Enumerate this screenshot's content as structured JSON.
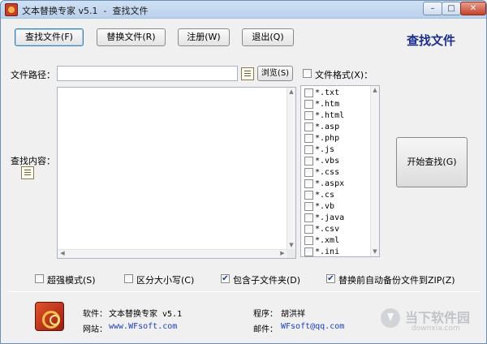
{
  "window": {
    "title": "文本替换专家 v5.1  -  查找文件",
    "controls": {
      "minimize": "–",
      "maximize": "□",
      "close": "✕"
    }
  },
  "toolbar": {
    "find_files": "查找文件(F)",
    "replace_files": "替换文件(R)",
    "register": "注册(W)",
    "exit": "退出(Q)"
  },
  "page_heading": "查找文件",
  "form": {
    "file_path_label": "文件路径：",
    "file_path_value": "",
    "browse_button": "浏览(S)",
    "file_format_label": "文件格式(X)：",
    "search_content_label": "查找内容：",
    "search_content_value": "",
    "start_button": "开始查找(G)"
  },
  "file_types": [
    {
      "label": "*.txt",
      "checked": false
    },
    {
      "label": "*.htm",
      "checked": false
    },
    {
      "label": "*.html",
      "checked": false
    },
    {
      "label": "*.asp",
      "checked": false
    },
    {
      "label": "*.php",
      "checked": false
    },
    {
      "label": "*.js",
      "checked": false
    },
    {
      "label": "*.vbs",
      "checked": false
    },
    {
      "label": "*.css",
      "checked": false
    },
    {
      "label": "*.aspx",
      "checked": false
    },
    {
      "label": "*.cs",
      "checked": false
    },
    {
      "label": "*.vb",
      "checked": false
    },
    {
      "label": "*.java",
      "checked": false
    },
    {
      "label": "*.csv",
      "checked": false
    },
    {
      "label": "*.xml",
      "checked": false
    },
    {
      "label": "*.ini",
      "checked": false
    }
  ],
  "options": [
    {
      "label": "超强模式(S)",
      "checked": false
    },
    {
      "label": "区分大小写(C)",
      "checked": false
    },
    {
      "label": "包含子文件夹(D)",
      "checked": true
    },
    {
      "label": "替换前自动备份文件到ZIP(Z)",
      "checked": true
    }
  ],
  "footer": {
    "software_label": "软件：",
    "software_value": "文本替换专家 v5.1",
    "website_label": "网站：",
    "website_value": "www.WFsoft.com",
    "author_label": "程序：",
    "author_value": "胡洪祥",
    "email_label": "邮件：",
    "email_value": "WFsoft@qq.com"
  },
  "watermark": {
    "main": "当下软件园",
    "sub": "downxia.com"
  },
  "colors": {
    "heading": "#1c2f8c",
    "link": "#1a3fbf"
  }
}
